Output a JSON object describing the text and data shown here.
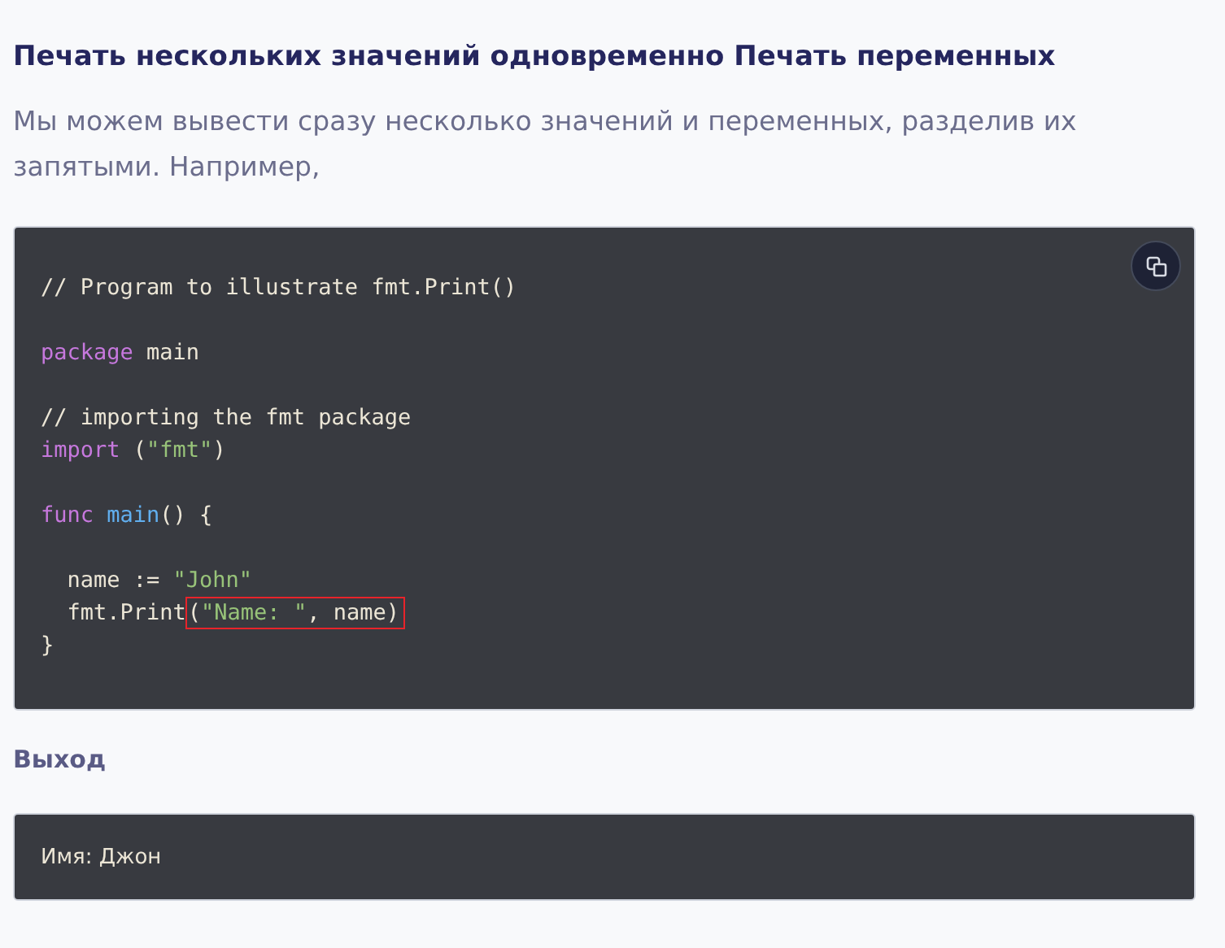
{
  "heading": "Печать нескольких значений одновременно Печать переменных",
  "intro": "Мы можем вывести сразу несколько значений и переменных, разделив их запятыми. Например,",
  "code": {
    "copy_button": true,
    "lines": [
      {
        "kind": "code",
        "segments": [
          {
            "highlighted": false,
            "tokens": [
              {
                "kind": "comment",
                "text": "// Program to illustrate fmt.Print()"
              }
            ]
          }
        ]
      },
      {
        "kind": "blank"
      },
      {
        "kind": "code",
        "segments": [
          {
            "highlighted": false,
            "tokens": [
              {
                "kind": "keyword",
                "text": "package"
              },
              {
                "kind": "plain",
                "text": " main"
              }
            ]
          }
        ]
      },
      {
        "kind": "blank"
      },
      {
        "kind": "code",
        "segments": [
          {
            "highlighted": false,
            "tokens": [
              {
                "kind": "comment",
                "text": "// importing the fmt package"
              }
            ]
          }
        ]
      },
      {
        "kind": "code",
        "segments": [
          {
            "highlighted": false,
            "tokens": [
              {
                "kind": "keyword",
                "text": "import"
              },
              {
                "kind": "plain",
                "text": " ("
              },
              {
                "kind": "string",
                "text": "\"fmt\""
              },
              {
                "kind": "plain",
                "text": ")"
              }
            ]
          }
        ]
      },
      {
        "kind": "blank"
      },
      {
        "kind": "code",
        "segments": [
          {
            "highlighted": false,
            "tokens": [
              {
                "kind": "keyword",
                "text": "func "
              },
              {
                "kind": "function",
                "text": "main"
              },
              {
                "kind": "plain",
                "text": "() {"
              }
            ]
          }
        ]
      },
      {
        "kind": "blank"
      },
      {
        "kind": "code",
        "segments": [
          {
            "highlighted": false,
            "tokens": [
              {
                "kind": "plain",
                "text": "  name := "
              },
              {
                "kind": "string",
                "text": "\"John\""
              }
            ]
          }
        ]
      },
      {
        "kind": "code",
        "segments": [
          {
            "highlighted": false,
            "tokens": [
              {
                "kind": "plain",
                "text": "  fmt.Print"
              }
            ]
          },
          {
            "highlighted": true,
            "tokens": [
              {
                "kind": "plain",
                "text": "("
              },
              {
                "kind": "string",
                "text": "\"Name: \""
              },
              {
                "kind": "plain",
                "text": ", name)"
              }
            ]
          }
        ]
      },
      {
        "kind": "code",
        "segments": [
          {
            "highlighted": false,
            "tokens": [
              {
                "kind": "plain",
                "text": "}"
              }
            ]
          }
        ]
      }
    ]
  },
  "output_heading": "Выход",
  "output": "Имя: Джон"
}
